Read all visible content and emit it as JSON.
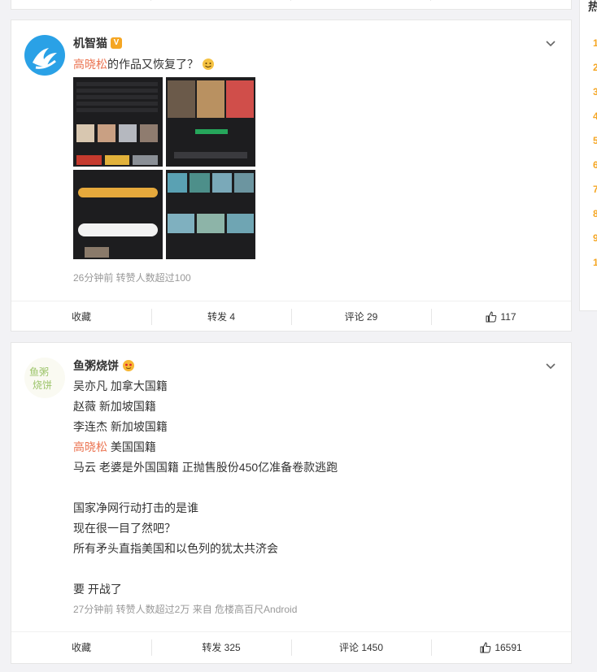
{
  "sidebar": {
    "title": "热",
    "ranks": [
      "1",
      "2",
      "3",
      "4",
      "5",
      "6",
      "7",
      "8",
      "9",
      "1"
    ]
  },
  "posts": [
    {
      "username": "机智猫",
      "badge": "V",
      "lines": [
        {
          "link": "高晓松",
          "text": "的作品又恢复了？"
        }
      ],
      "meta": "26分钟前 转赞人数超过100",
      "actions": {
        "collect": "收藏",
        "repost": "转发 4",
        "comment": "评论 29",
        "like": "117"
      }
    },
    {
      "username": "鱼粥烧饼",
      "lines": [
        {
          "link": "",
          "text": "吴亦凡 加拿大国籍"
        },
        {
          "link": "",
          "text": "赵薇 新加坡国籍"
        },
        {
          "link": "",
          "text": "李连杰 新加坡国籍"
        },
        {
          "link": "高晓松",
          "text": " 美国国籍"
        },
        {
          "link": "",
          "text": "马云 老婆是外国国籍 正抛售股份450亿准备卷款逃跑"
        },
        {
          "link": "",
          "text": "国家净网行动打击的是谁"
        },
        {
          "link": "",
          "text": "现在很一目了然吧？"
        },
        {
          "link": "",
          "text": "所有矛头直指美国和以色列的犹太共济会"
        },
        {
          "link": "",
          "text": "要 开战了"
        }
      ],
      "meta": "27分钟前 转赞人数超过2万  来自 危楼高百尺Android",
      "actions": {
        "collect": "收藏",
        "repost": "转发 325",
        "comment": "评论 1450",
        "like": "16591"
      }
    }
  ],
  "colors": {
    "link": "#eb7350",
    "rank": "#f5a623",
    "verified": "#f5a623"
  }
}
